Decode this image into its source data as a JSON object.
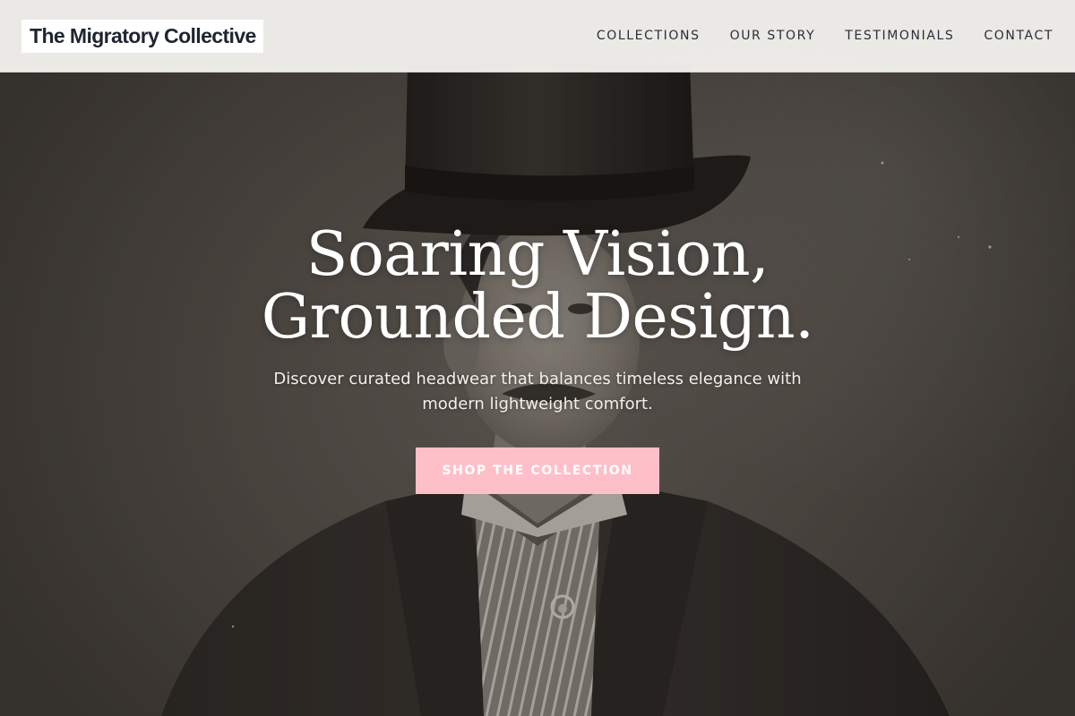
{
  "brand": {
    "name": "The Migratory Collective"
  },
  "nav": {
    "items": [
      {
        "label": "COLLECTIONS"
      },
      {
        "label": "OUR STORY"
      },
      {
        "label": "TESTIMONIALS"
      },
      {
        "label": "CONTACT"
      }
    ]
  },
  "hero": {
    "headline_line1": "Soaring Vision,",
    "headline_line2": "Grounded Design.",
    "subtitle": "Discover curated headwear that balances timeless elegance with modern lightweight comfort.",
    "cta_label": "SHOP THE COLLECTION",
    "image_subject": "vintage-portrait-man-top-hat"
  },
  "colors": {
    "header_bg": "#f2f0ed",
    "logo_text": "#1e2530",
    "nav_text": "#2a2f38",
    "cta_bg": "#ffbfc9",
    "cta_text": "#ffffff",
    "headline": "#ffffff"
  }
}
